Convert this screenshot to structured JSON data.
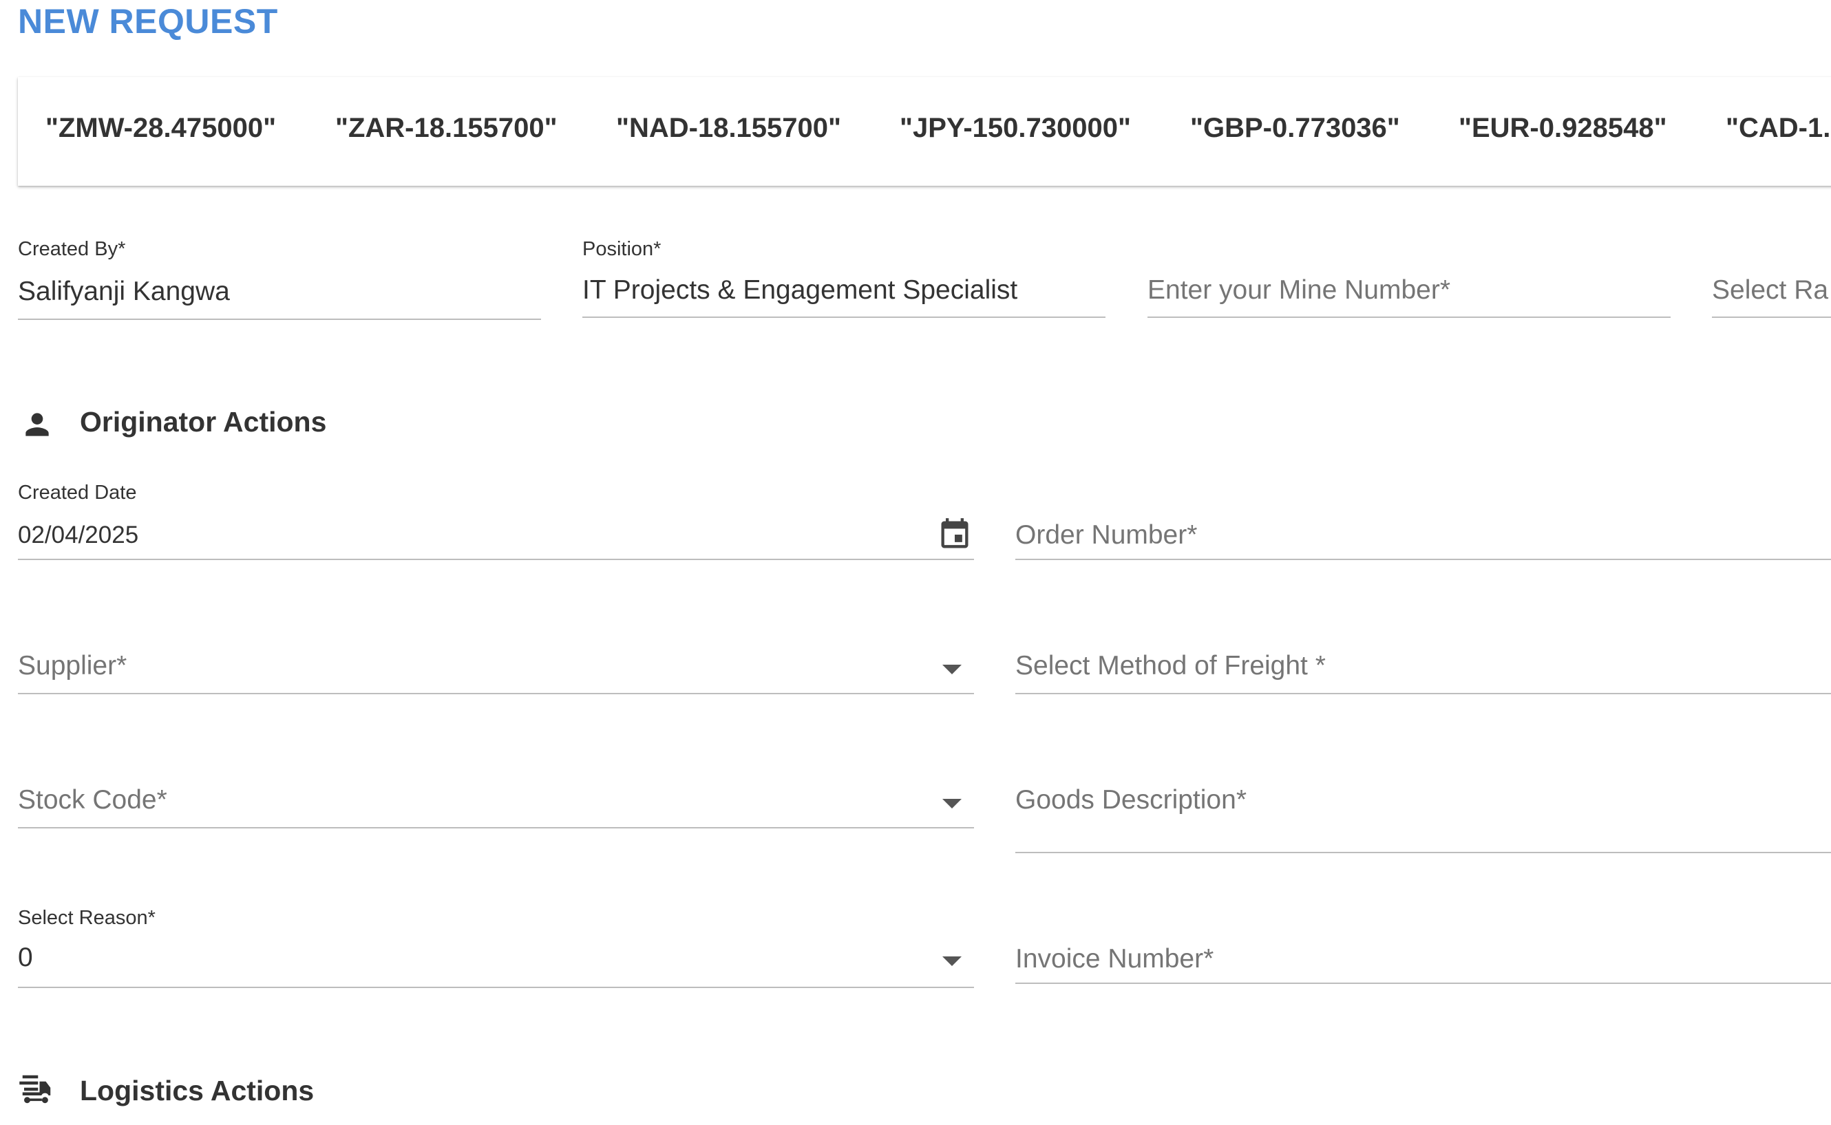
{
  "header": {
    "title": "NEW REQUEST"
  },
  "rates": [
    "\"ZMW-28.475000\"",
    "\"ZAR-18.155700\"",
    "\"NAD-18.155700\"",
    "\"JPY-150.730000\"",
    "\"GBP-0.773036\"",
    "\"EUR-0.928548\"",
    "\"CAD-1."
  ],
  "top_fields": {
    "created_by": {
      "label": "Created By*",
      "value": "Salifyanji Kangwa"
    },
    "position": {
      "label": "Position*",
      "value": "IT Projects & Engagement Specialist"
    },
    "mine_number": {
      "placeholder": "Enter your Mine Number*"
    },
    "select_rate": {
      "placeholder": "Select Ra"
    }
  },
  "originator": {
    "title": "Originator Actions",
    "icon": "person-icon",
    "created_date": {
      "label": "Created Date",
      "value": "02/04/2025"
    },
    "order_number": {
      "placeholder": "Order Number*"
    },
    "supplier": {
      "placeholder": "Supplier*"
    },
    "freight": {
      "placeholder": "Select Method of Freight *"
    },
    "stock_code": {
      "placeholder": "Stock Code*"
    },
    "goods_description": {
      "placeholder": "Goods Description*"
    },
    "reason": {
      "label": "Select Reason*",
      "value": "0"
    },
    "invoice_number": {
      "placeholder": "Invoice Number*"
    }
  },
  "logistics": {
    "title": "Logistics Actions",
    "icon": "delivery-truck-icon"
  },
  "colors": {
    "accent": "#4a8ad8",
    "text": "#333333",
    "placeholder": "#757575",
    "underline": "#bdbdbd"
  }
}
